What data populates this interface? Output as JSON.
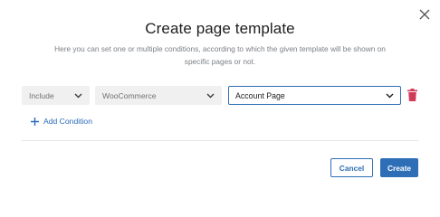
{
  "dialog": {
    "title": "Create page template",
    "description": "Here you can set one or multiple conditions, according to which the given template will be shown on specific pages or not."
  },
  "condition": {
    "type_value": "Include",
    "source_value": "WooCommerce",
    "page_value": "Account Page"
  },
  "add_condition_label": "Add Condition",
  "buttons": {
    "cancel_label": "Cancel",
    "create_label": "Create"
  },
  "colors": {
    "accent": "#2d6eb7",
    "delete": "#d23a5a"
  },
  "icons": {
    "close": "close-icon",
    "chevron": "chevron-down-icon",
    "delete": "trash-icon",
    "add": "plus-icon"
  }
}
